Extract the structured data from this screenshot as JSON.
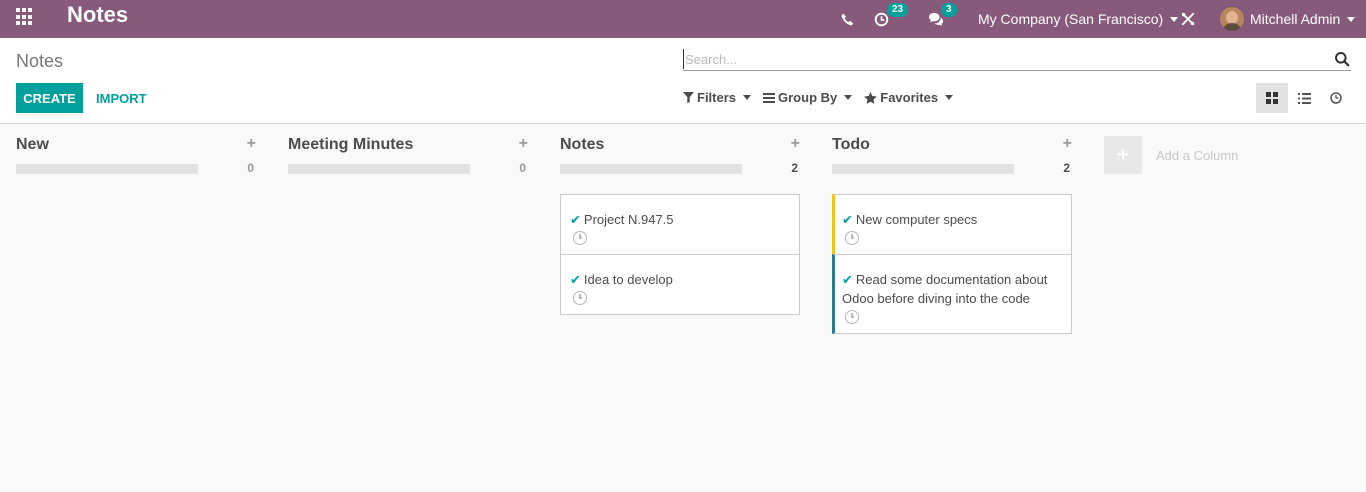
{
  "navbar": {
    "app_title": "Notes",
    "activities_count": "23",
    "messages_count": "3",
    "company": "My Company (San Francisco)",
    "user": "Mitchell Admin",
    "bg_color": "#875a7b",
    "accent_color": "#00a09d"
  },
  "control": {
    "breadcrumb": "Notes",
    "create_label": "CREATE",
    "import_label": "IMPORT",
    "search_placeholder": "Search...",
    "filters_label": "Filters",
    "group_by_label": "Group By",
    "favorites_label": "Favorites"
  },
  "kanban": {
    "columns": [
      {
        "title": "New",
        "count": "0",
        "cards": []
      },
      {
        "title": "Meeting Minutes",
        "count": "0",
        "cards": []
      },
      {
        "title": "Notes",
        "count": "2",
        "cards": [
          {
            "title": "Project N.947.5"
          },
          {
            "title": "Idea to develop"
          }
        ]
      },
      {
        "title": "Todo",
        "count": "2",
        "cards": [
          {
            "title": "New computer specs",
            "border_color": "#f0c419"
          },
          {
            "title": "Read some documentation about Odoo before diving into the code",
            "border_color": "#2c7b8c"
          }
        ]
      }
    ],
    "add_column_label": "Add a Column"
  }
}
